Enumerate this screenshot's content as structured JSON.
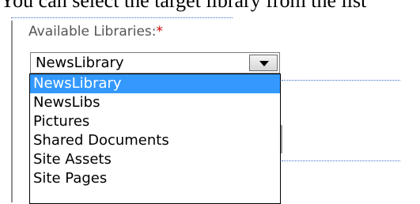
{
  "intro": {
    "text": "You can select the target library from the list"
  },
  "form": {
    "label": "Available Libraries:",
    "required_marker": "*",
    "colors": {
      "required": "#d00000",
      "selection": "#3399ff",
      "label": "#555555"
    }
  },
  "library_select": {
    "value": "NewsLibrary",
    "options": [
      "NewsLibrary",
      "NewsLibs",
      "Pictures",
      "Shared Documents",
      "Site Assets",
      "Site Pages"
    ],
    "selected_index": 0
  }
}
